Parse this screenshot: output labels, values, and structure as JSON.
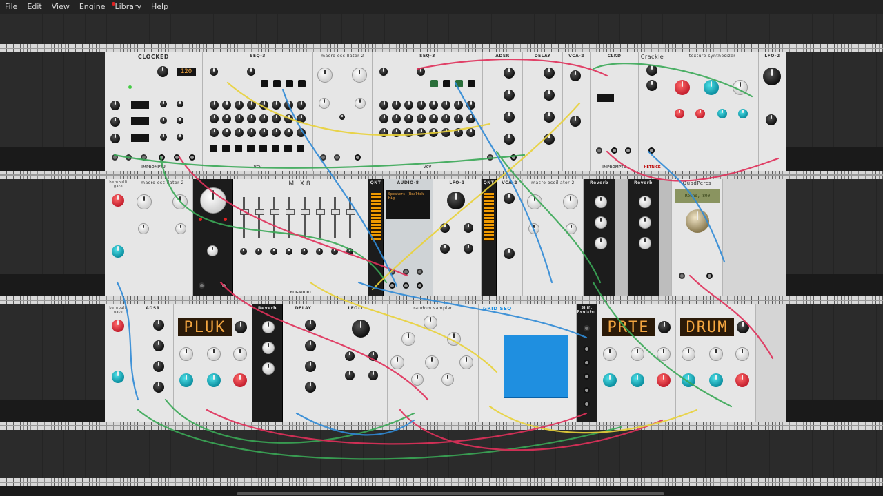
{
  "menu": {
    "items": [
      {
        "label": "File"
      },
      {
        "label": "Edit"
      },
      {
        "label": "View"
      },
      {
        "label": "Engine"
      },
      {
        "label": "Library"
      },
      {
        "label": "Help"
      }
    ]
  },
  "modules": {
    "clocked": "CLOCKED",
    "clocked_display": "120",
    "seq3_a": "SEQ-3",
    "macro_osc_a": "macro oscillator 2",
    "seq3_b": "SEQ-3",
    "adsr_a": "ADSR",
    "delay_a": "DELAY",
    "vca2_a": "VCA-2",
    "clkd": "CLKD",
    "crackle": "Crackle",
    "texture_synth": "texture synthesizer",
    "lfo2": "LFO-2",
    "bernoulli_a": "bernoulli gate",
    "macro_osc_b": "macro oscillator 2",
    "mix8": "MIX8",
    "qnt_a": "QNT",
    "audio8": "AUDIO-8",
    "audio_device": "Speakers (Realtek Hig",
    "lfo1_a": "LFO-1",
    "qnt_b": "QNT",
    "vca2_b": "VCA-2",
    "macro_osc_c": "macro oscillator 2",
    "reverb_a": "Reverb",
    "reverb_b": "Reverb",
    "quadpercs": "QuadPercs",
    "quadpercs_display": "Round, 800",
    "bernoulli_b": "bernoulli gate",
    "adsr_b": "ADSR",
    "plukdisplay": "PLUK",
    "reverb_c": "Reverb",
    "delay_b": "DELAY",
    "lfo1_b": "LFO-1",
    "random_sampler": "random sampler",
    "grid_seq": "GRID SEQ",
    "shift_register": "Shift Register",
    "prte_display": "PRTE",
    "drum_display": "DRUM",
    "vcv": "VCV",
    "hetrick": "HETRICK",
    "impromptu": "IMPROMPTU",
    "bogaudio": "BOGAUDIO"
  },
  "colors": {
    "menubar": "#232323",
    "panel": "#e6e6e6",
    "grid_pad": "#1f8fe0",
    "cable_red": "#e0305a",
    "cable_green": "#3aa856",
    "cable_yellow": "#e9d23a",
    "cable_blue": "#2f8ad6"
  }
}
